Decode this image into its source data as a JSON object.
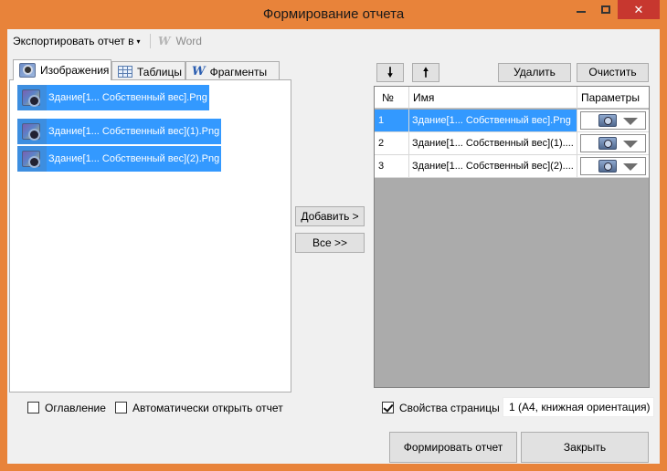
{
  "window": {
    "title": "Формирование отчета",
    "frame_color": "#e8833a",
    "close_glyph": "✕"
  },
  "toolbar": {
    "export_label": "Экспортировать отчет в",
    "export_caret": "▾",
    "word_icon": "W",
    "word_label": "Word"
  },
  "tabs": [
    {
      "label": "Изображения",
      "icon": "image-icon",
      "active": true
    },
    {
      "label": "Таблицы",
      "icon": "table-icon",
      "active": false
    },
    {
      "label": "Фрагменты",
      "icon": "word-icon",
      "icon_glyph": "W",
      "active": false
    }
  ],
  "source_list": {
    "items": [
      {
        "name": "Здание[1... Собственный вес].Png",
        "selected": true
      },
      {
        "name": "Здание[1... Собственный вес](1).Png",
        "selected": true
      },
      {
        "name": "Здание[1... Собственный вес](2).Png",
        "selected": true
      }
    ]
  },
  "transfer": {
    "add_label": "Добавить >",
    "all_label": "Все >>"
  },
  "order": {
    "down_glyph": "🠗",
    "up_glyph": "🠕",
    "delete_label": "Удалить",
    "clear_label": "Очистить"
  },
  "report_grid": {
    "headers": [
      "№",
      "Имя",
      "Параметры"
    ],
    "rows": [
      {
        "num": "1",
        "name": "Здание[1... Собственный вес].Png",
        "selected": true
      },
      {
        "num": "2",
        "name": "Здание[1... Собственный вес](1)....",
        "selected": false
      },
      {
        "num": "3",
        "name": "Здание[1... Собственный вес](2)....",
        "selected": false
      }
    ]
  },
  "options": {
    "toc_label": "Оглавление",
    "toc_checked": false,
    "auto_open_label": "Автоматически открыть отчет",
    "auto_open_checked": false,
    "page_props_label": "Свойства страницы",
    "page_props_checked": true,
    "page_info": "1 (A4, книжная ориентация)"
  },
  "footer": {
    "build_label": "Формировать отчет",
    "close_label": "Закрыть"
  },
  "colors": {
    "selection": "#3399ff",
    "grid_background": "#ababab"
  }
}
